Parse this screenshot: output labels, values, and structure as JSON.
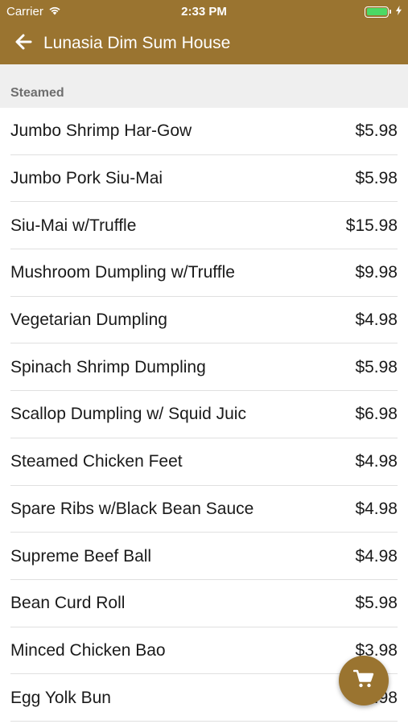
{
  "status_bar": {
    "carrier": "Carrier",
    "time": "2:33 PM",
    "battery_level": 1.0
  },
  "header": {
    "title": "Lunasia Dim Sum House",
    "back_icon": "arrow-left-icon"
  },
  "section": {
    "title": "Steamed"
  },
  "menu_items": [
    {
      "name": "Jumbo Shrimp Har-Gow",
      "price": "$5.98"
    },
    {
      "name": "Jumbo Pork Siu-Mai",
      "price": "$5.98"
    },
    {
      "name": "Siu-Mai w/Truffle",
      "price": "$15.98"
    },
    {
      "name": "Mushroom Dumpling w/Truffle",
      "price": "$9.98"
    },
    {
      "name": "Vegetarian Dumpling",
      "price": "$4.98"
    },
    {
      "name": "Spinach Shrimp Dumpling",
      "price": "$5.98"
    },
    {
      "name": "Scallop Dumpling w/ Squid Juic",
      "price": "$6.98"
    },
    {
      "name": "Steamed Chicken Feet",
      "price": "$4.98"
    },
    {
      "name": "Spare Ribs w/Black Bean Sauce",
      "price": "$4.98"
    },
    {
      "name": "Supreme Beef Ball",
      "price": "$4.98"
    },
    {
      "name": "Bean Curd Roll",
      "price": "$5.98"
    },
    {
      "name": "Minced Chicken Bao",
      "price": "$3.98"
    },
    {
      "name": "Egg Yolk Bun",
      "price": "$4.98"
    }
  ],
  "cart_button": {
    "icon": "shopping-cart-icon"
  },
  "colors": {
    "brand": "#9a7430",
    "section_bg": "#efefef",
    "battery": "#4cd964"
  }
}
